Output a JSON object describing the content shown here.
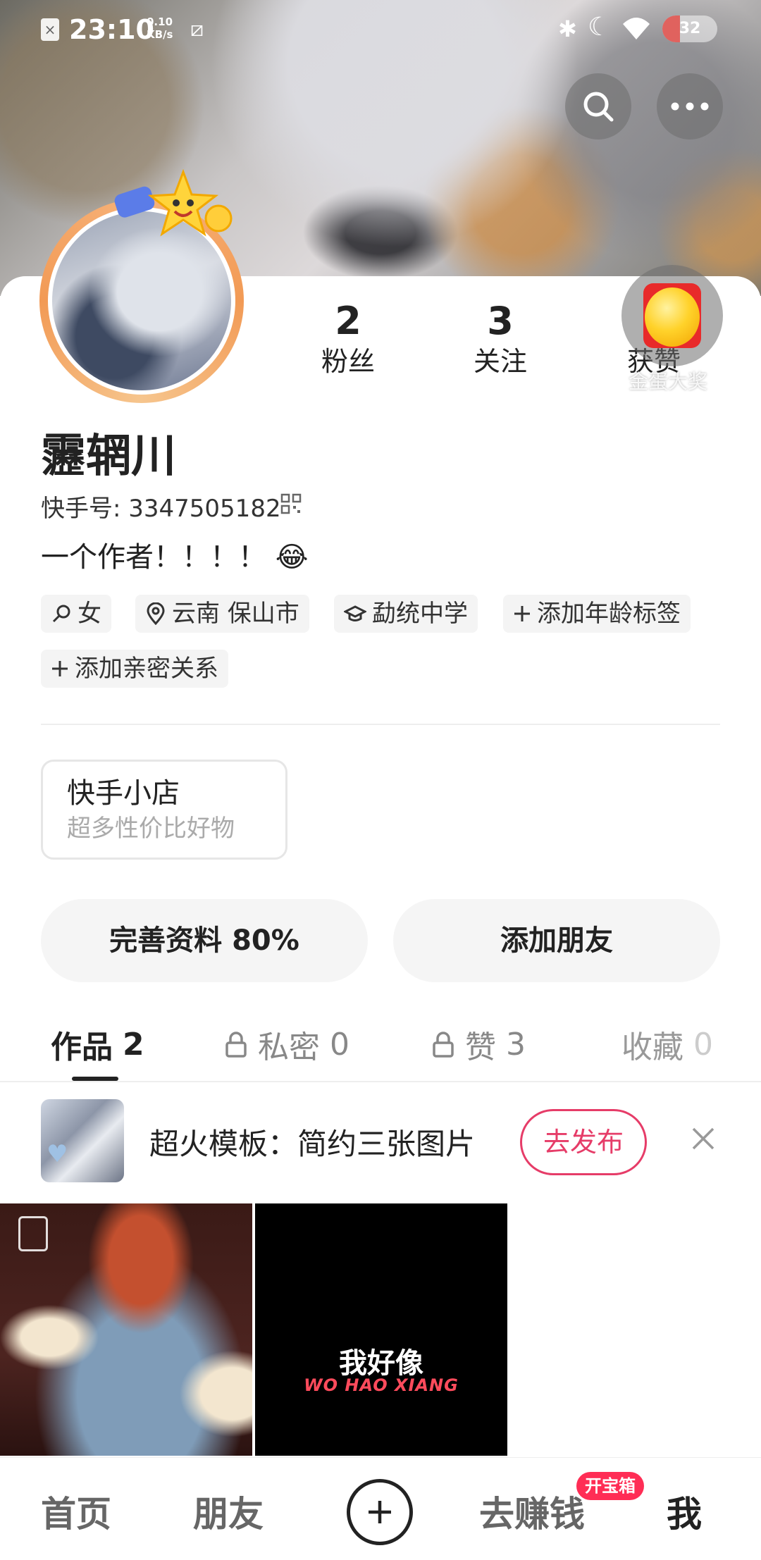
{
  "status_bar": {
    "time": "23:10",
    "net_speed_value": "0.10",
    "net_speed_unit": "KB/s",
    "battery": "32",
    "battery_level": 0.32
  },
  "profile": {
    "fans_count": "2",
    "fans_label": "粉丝",
    "following_count": "3",
    "following_label": "关注",
    "likes_label": "获赞",
    "egg_label": "金蛋大奖",
    "name": "靋辋川",
    "kuaishou_id": "快手号: 3347505182",
    "bio": "一个作者！！！！ 😂"
  },
  "tags": {
    "gender": "女",
    "location": "云南 保山市",
    "school": "勐统中学",
    "add_age": "添加年龄标签",
    "add_relation": "添加亲密关系"
  },
  "shop": {
    "title": "快手小店",
    "subtitle": "超多性价比好物"
  },
  "actions": {
    "complete_profile": "完善资料 80%",
    "add_friend": "添加朋友"
  },
  "tabs": [
    {
      "label": "作品",
      "count": "2"
    },
    {
      "label": "私密",
      "count": "0"
    },
    {
      "label": "赞",
      "count": "3"
    },
    {
      "label": "收藏",
      "count": "0"
    }
  ],
  "promo": {
    "text": "超火模板：简约三张图片",
    "button": "去发布"
  },
  "works": {
    "item2_title": "我好像",
    "item2_pinyin": "WO HAO XIANG"
  },
  "bottom_nav": {
    "home": "首页",
    "friends": "朋友",
    "earn": "去赚钱",
    "earn_badge": "开宝箱",
    "me": "我"
  },
  "colors": {
    "accent": "#e63c68",
    "badge": "#ff2d55",
    "avatar_ring": "#f29a55"
  }
}
